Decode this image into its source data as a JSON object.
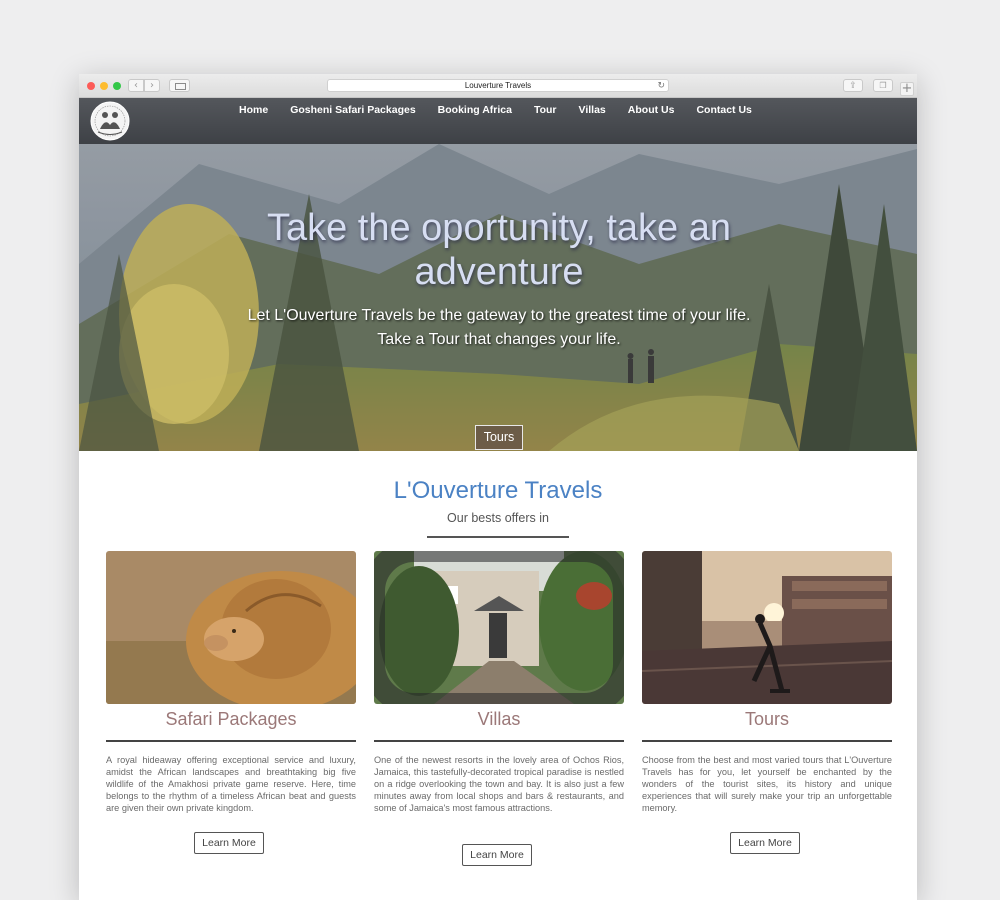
{
  "browser": {
    "url_title": "Louverture Travels"
  },
  "nav": {
    "items": [
      {
        "label": "Home"
      },
      {
        "label": "Gosheni Safari Packages"
      },
      {
        "label": "Booking Africa"
      },
      {
        "label": "Tour"
      },
      {
        "label": "Villas"
      },
      {
        "label": "About Us"
      },
      {
        "label": "Contact Us"
      }
    ]
  },
  "hero": {
    "title": "Take the oportunity, take an adventure",
    "subtitle": "Let L'Ouverture Travels be the gateway to the greatest time of your life. Take a Tour that changes your life.",
    "button": "Tours"
  },
  "offers": {
    "title": "L'Ouverture Travels",
    "subtitle": "Our bests offers in",
    "cards": [
      {
        "title": "Safari Packages",
        "description": "A royal hideaway offering exceptional service and luxury, amidst the African landscapes and breathtaking big five wildlife of the Amakhosi private game reserve. Here, time belongs to the rhythm of a timeless African beat and guests are given their own private kingdom.",
        "button": "Learn More"
      },
      {
        "title": "Villas",
        "description": "One of the newest resorts in the lovely area of Ochos Rios, Jamaica, this tastefully-decorated tropical paradise is nestled on a ridge overlooking the town and bay. It is also just a few minutes away from local shops and bars & restaurants, and some of Jamaica's most famous attractions.",
        "button": "Learn More"
      },
      {
        "title": "Tours",
        "description": "Choose from the best and most varied tours that L'Ouverture Travels has for you, let yourself be enchanted by the wonders of the tourist sites, its history and unique experiences that will surely make your trip an unforgettable memory.",
        "button": "Learn More"
      }
    ]
  },
  "colors": {
    "accent": "#4b82c4",
    "card_title": "#9b7878",
    "header_bg": "#46494e"
  }
}
